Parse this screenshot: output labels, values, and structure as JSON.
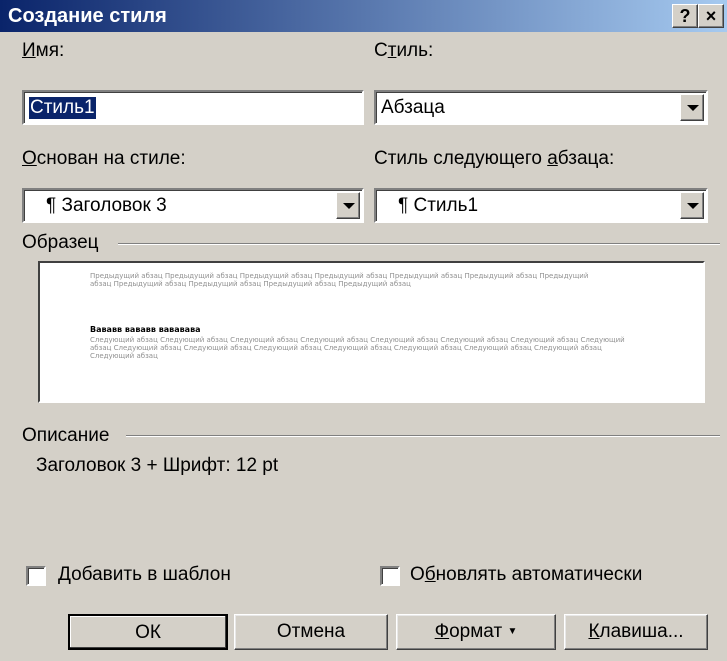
{
  "window": {
    "title": "Создание стиля",
    "help_label": "?",
    "close_label": "×"
  },
  "name_field": {
    "label_first": "И",
    "label_rest": "мя:",
    "value": "Стиль1"
  },
  "style_type": {
    "label_first": "С",
    "label_u": "т",
    "label_rest": "иль:",
    "value": "Абзаца"
  },
  "based_on": {
    "label_u": "О",
    "label_rest": "снован на стиле:",
    "value": "¶ Заголовок 3"
  },
  "next_style": {
    "label_start": "Стиль следующего ",
    "label_u": "а",
    "label_rest": "бзаца:",
    "value": "¶ Стиль1"
  },
  "sample": {
    "label": "Образец",
    "preceding_text": "Предыдущий абзац Предыдущий абзац Предыдущий абзац Предыдущий абзац Предыдущий абзац Предыдущий абзац Предыдущий абзац Предыдущий абзац Предыдущий абзац Предыдущий абзац Предыдущий абзац",
    "current_text": "Вававв вававв вававава",
    "following_text": "Следующий абзац Следующий абзац Следующий абзац Следующий абзац Следующий абзац Следующий абзац Следующий абзац Следующий абзац Следующий абзац Следующий абзац Следующий абзац Следующий абзац Следующий абзац Следующий абзац Следующий абзац Следующий абзац"
  },
  "description": {
    "label": "Описание",
    "text": "Заголовок 3 + Шрифт: 12 pt"
  },
  "add_to_template": {
    "label_u": "Д",
    "label_rest": "обавить в шаблон",
    "checked": false
  },
  "auto_update": {
    "label_start": "О",
    "label_u": "б",
    "label_rest": "новлять автоматически",
    "checked": false
  },
  "buttons": {
    "ok": "ОК",
    "cancel": "Отмена",
    "format_u": "Ф",
    "format_rest": "ормат",
    "format_arrow": "▼",
    "shortcut_u": "К",
    "shortcut_rest": "лавиша..."
  }
}
